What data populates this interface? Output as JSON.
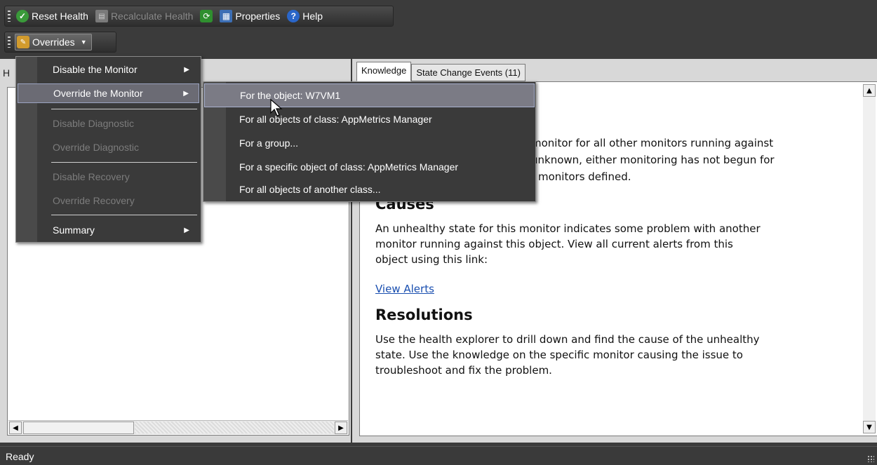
{
  "toolbar": {
    "reset_health": "Reset Health",
    "recalculate_health": "Recalculate Health",
    "properties": "Properties",
    "help": "Help"
  },
  "overrides_toolbar": {
    "overrides": "Overrides"
  },
  "left_pane": {
    "header": "H"
  },
  "tabs": [
    {
      "label": "Knowledge",
      "active": true
    },
    {
      "label": "State Change Events (11)",
      "active": false
    }
  ],
  "knowledge": {
    "summary_lines": [
      "monitor for all other monitors running against",
      "unknown, either monitoring has not begun for",
      "monitors defined."
    ],
    "causes_heading": "Causes",
    "causes_lines": [
      "An unhealthy state for this monitor indicates some problem with another",
      "monitor running against this object. View all current alerts from this",
      "object using this link:"
    ],
    "view_alerts_link": "View Alerts",
    "resolutions_heading": "Resolutions",
    "resolutions_lines": [
      "Use the health explorer to drill down and find the cause of the unhealthy",
      "state. Use the knowledge on the specific monitor causing the issue to",
      "troubleshoot and fix the problem."
    ]
  },
  "overrides_menu": {
    "items": [
      {
        "label": "Disable the Monitor",
        "enabled": true,
        "submenu": true
      },
      {
        "label": "Override the Monitor",
        "enabled": true,
        "submenu": true,
        "highlighted": true
      },
      {
        "label": "Disable Diagnostic",
        "enabled": false
      },
      {
        "label": "Override Diagnostic",
        "enabled": false
      },
      {
        "label": "Disable Recovery",
        "enabled": false
      },
      {
        "label": "Override Recovery",
        "enabled": false
      },
      {
        "label": "Summary",
        "enabled": true,
        "submenu": true
      }
    ]
  },
  "override_submenu": {
    "items": [
      {
        "label": "For the object: W7VM1",
        "highlighted": true
      },
      {
        "label": "For all objects of class: AppMetrics Manager"
      },
      {
        "label": "For a group..."
      },
      {
        "label": "For a specific object of class: AppMetrics Manager"
      },
      {
        "label": "For all objects of another class..."
      }
    ]
  },
  "status": {
    "text": "Ready"
  }
}
